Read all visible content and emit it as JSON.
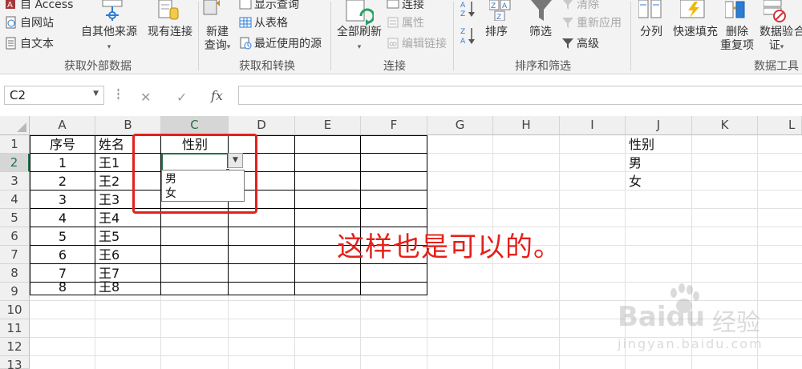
{
  "ribbon": {
    "get_external_data": {
      "access_label": "自 Access",
      "web_label": "自网站",
      "text_label": "自文本",
      "other_sources_label": "自其他来源",
      "existing_connections_label": "现有连接",
      "group_label": "获取外部数据"
    },
    "get_transform": {
      "new_query_label_1": "新建",
      "new_query_label_2": "查询",
      "show_queries_label": "显示查询",
      "from_table_label": "从表格",
      "recent_sources_label": "最近使用的源",
      "group_label": "获取和转换"
    },
    "connections": {
      "refresh_all_label": "全部刷新",
      "connections_label": "连接",
      "properties_label": "属性",
      "edit_links_label": "编辑链接",
      "group_label": "连接"
    },
    "sort_filter": {
      "sort_label": "排序",
      "filter_label": "筛选",
      "clear_label": "清除",
      "reapply_label": "重新应用",
      "advanced_label": "高级",
      "group_label": "排序和筛选"
    },
    "data_tools": {
      "text_to_columns_label": "分列",
      "flash_fill_label": "快速填充",
      "remove_duplicates_label_1": "删除",
      "remove_duplicates_label_2": "重复项",
      "data_validation_label_1": "数据验",
      "data_validation_label_2": "证",
      "consolidate_label": "合",
      "group_label": "数据工具"
    }
  },
  "formula_bar": {
    "name_box": "C2",
    "fx_label": "fx",
    "cancel_symbol": "✕",
    "enter_symbol": "✓",
    "value": ""
  },
  "sheet": {
    "columns": [
      "A",
      "B",
      "C",
      "D",
      "E",
      "F",
      "G",
      "H",
      "I",
      "J",
      "K",
      "L"
    ],
    "rows": [
      "1",
      "2",
      "3",
      "4",
      "5",
      "6",
      "7",
      "8",
      "9",
      "10",
      "11",
      "12",
      "13"
    ],
    "active_cell": "C2",
    "table_header": [
      "序号",
      "姓名",
      "性别"
    ],
    "table_rows": [
      [
        "1",
        "王1"
      ],
      [
        "2",
        "王2"
      ],
      [
        "3",
        "王3"
      ],
      [
        "4",
        "王4"
      ],
      [
        "5",
        "王5"
      ],
      [
        "6",
        "王6"
      ],
      [
        "7",
        "王7"
      ],
      [
        "8",
        "王8"
      ]
    ],
    "side_list": [
      "性别",
      "男",
      "女"
    ]
  },
  "dropdown": {
    "options": [
      "男",
      "女"
    ]
  },
  "annotation_text": "这样也是可以的。",
  "watermark": {
    "brand": "Baidu",
    "brand_cn": "经验",
    "url": "jingyan.baidu.com"
  },
  "colors": {
    "accent_green": "#217346",
    "annotation_red": "#e4201a"
  }
}
